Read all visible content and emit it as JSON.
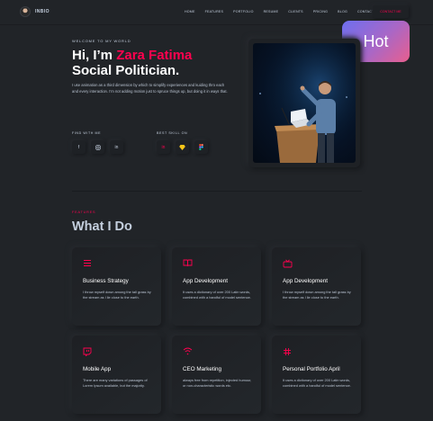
{
  "header": {
    "logo_text": "INBIO",
    "nav": [
      "HOME",
      "FEATURES",
      "PORTFOLIO",
      "RESUME",
      "CLIENTS",
      "PRICING",
      "BLOG",
      "CONTACT"
    ],
    "cta": "CONTACT ME"
  },
  "badge": {
    "label": "Hot"
  },
  "hero": {
    "welcome": "WELCOME TO MY WORLD",
    "greeting": "Hi, I’m ",
    "name": "Zara Fatima",
    "role": "Social Politician.",
    "description": "I use animation as a third dimension by which to simplify experiences and kuiding thro each and every interaction. I’m not adding motion just to spruce things up, but doing it in ways that.",
    "find_label": "FIND WITH ME",
    "skill_label": "BEST SKILL ON"
  },
  "features": {
    "label": "FEATURES",
    "title": "What I Do",
    "cards": [
      {
        "icon": "menu-icon",
        "title": "Business Strategy",
        "text": "I throw myself down among the tall grass by the stream as I lie close to the earth."
      },
      {
        "icon": "book-icon",
        "title": "App Development",
        "text": "It uses a dictionary of over 200 Latin words, combined with a handful of model sentence."
      },
      {
        "icon": "tv-icon",
        "title": "App Development",
        "text": "I throw myself down among the tall grass by the stream as I lie close to the earth."
      },
      {
        "icon": "twitch-icon",
        "title": "Mobile App",
        "text": "There are many variations of passages of Lorem Ipsum available, but the majority."
      },
      {
        "icon": "wifi-icon",
        "title": "CEO Marketing",
        "text": "always free from repetition, injected humour, or non-characteristic words etc."
      },
      {
        "icon": "slack-icon",
        "title": "Personal Portfolio April",
        "text": "It uses a dictionary of over 200 Latin words, combined with a handful of model sentence."
      }
    ]
  },
  "colors": {
    "accent": "#ff014f",
    "background": "#212428",
    "badge_start": "#6d6ff0",
    "badge_end": "#e85f8e"
  }
}
